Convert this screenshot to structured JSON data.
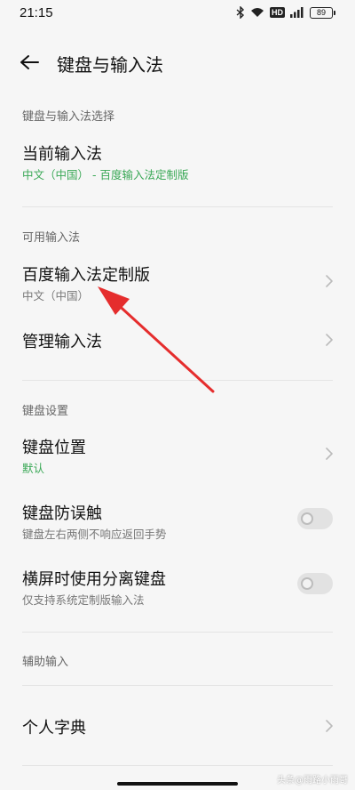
{
  "status_bar": {
    "time": "21:15",
    "icons": [
      "bluetooth-icon",
      "wifi-icon",
      "hd-icon",
      "signal-icon",
      "battery-icon"
    ],
    "hd_label": "HD",
    "battery_level": "89"
  },
  "header": {
    "title": "键盘与输入法"
  },
  "sections": {
    "select": {
      "label": "键盘与输入法选择",
      "current": {
        "title": "当前输入法",
        "subtitle": "中文（中国） - 百度输入法定制版"
      }
    },
    "available": {
      "label": "可用输入法",
      "baidu": {
        "title": "百度输入法定制版",
        "subtitle": "中文（中国）"
      },
      "manage": {
        "title": "管理输入法"
      }
    },
    "keyboard": {
      "label": "键盘设置",
      "position": {
        "title": "键盘位置",
        "subtitle": "默认"
      },
      "mistouch": {
        "title": "键盘防误触",
        "subtitle": "键盘左右两侧不响应返回手势",
        "enabled": false
      },
      "split": {
        "title": "横屏时使用分离键盘",
        "subtitle": "仅支持系统定制版输入法",
        "enabled": false
      }
    },
    "assist": {
      "label": "辅助输入",
      "dictionary": {
        "title": "个人字典"
      }
    }
  },
  "watermark": "头条@雨路小雨哥",
  "colors": {
    "accent_green": "#3aa856",
    "annotation_red": "#e52d2d",
    "background": "#f6f6f6"
  }
}
